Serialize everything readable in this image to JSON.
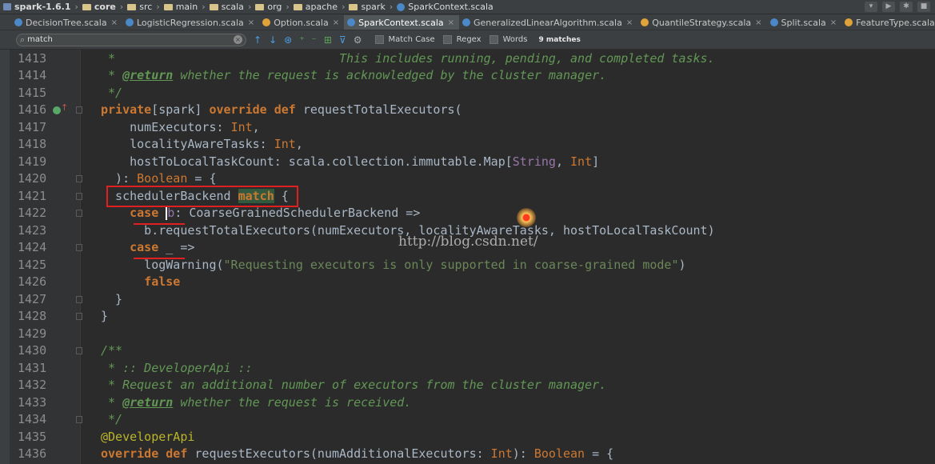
{
  "breadcrumb": {
    "items": [
      {
        "label": "spark-1.6.1",
        "icon": "project-icon",
        "bold": true
      },
      {
        "label": "core",
        "icon": "folder-icon",
        "bold": true
      },
      {
        "label": "src",
        "icon": "folder-icon"
      },
      {
        "label": "main",
        "icon": "folder-icon"
      },
      {
        "label": "scala",
        "icon": "folder-icon"
      },
      {
        "label": "org",
        "icon": "folder-icon"
      },
      {
        "label": "apache",
        "icon": "folder-icon"
      },
      {
        "label": "spark",
        "icon": "folder-icon"
      },
      {
        "label": "SparkContext.scala",
        "icon": "scala-file-icon"
      }
    ]
  },
  "tabs": [
    {
      "label": "DecisionTree.scala",
      "color": "#4a88c7",
      "active": false
    },
    {
      "label": "LogisticRegression.scala",
      "color": "#4a88c7",
      "active": false
    },
    {
      "label": "Option.scala",
      "color": "#e0a33a",
      "active": false
    },
    {
      "label": "SparkContext.scala",
      "color": "#4a88c7",
      "active": true
    },
    {
      "label": "GeneralizedLinearAlgorithm.scala",
      "color": "#4a88c7",
      "active": false
    },
    {
      "label": "QuantileStrategy.scala",
      "color": "#e0a33a",
      "active": false
    },
    {
      "label": "Split.scala",
      "color": "#4a88c7",
      "active": false
    },
    {
      "label": "FeatureType.scala",
      "color": "#e0a33a",
      "active": false
    }
  ],
  "find": {
    "query": "match",
    "match_case_label": "Match Case",
    "regex_label": "Regex",
    "words_label": "Words",
    "matches_label": "9 matches"
  },
  "editor": {
    "line_numbers": [
      "1413",
      "1414",
      "1415",
      "1416",
      "1417",
      "1418",
      "1419",
      "1420",
      "1421",
      "1422",
      "1423",
      "1424",
      "1425",
      "1426",
      "1427",
      "1428",
      "1429",
      "1430",
      "1431",
      "1432",
      "1433",
      "1434",
      "1435",
      "1436"
    ],
    "watermark": "http://blog.csdn.net/"
  },
  "colors": {
    "keyword": "#cc7832",
    "comment": "#629755",
    "string": "#6a8759",
    "annotation": "#bbb529",
    "text": "#a9b7c6",
    "match_highlight": "#32593d",
    "annotation_red": "#e02020"
  }
}
